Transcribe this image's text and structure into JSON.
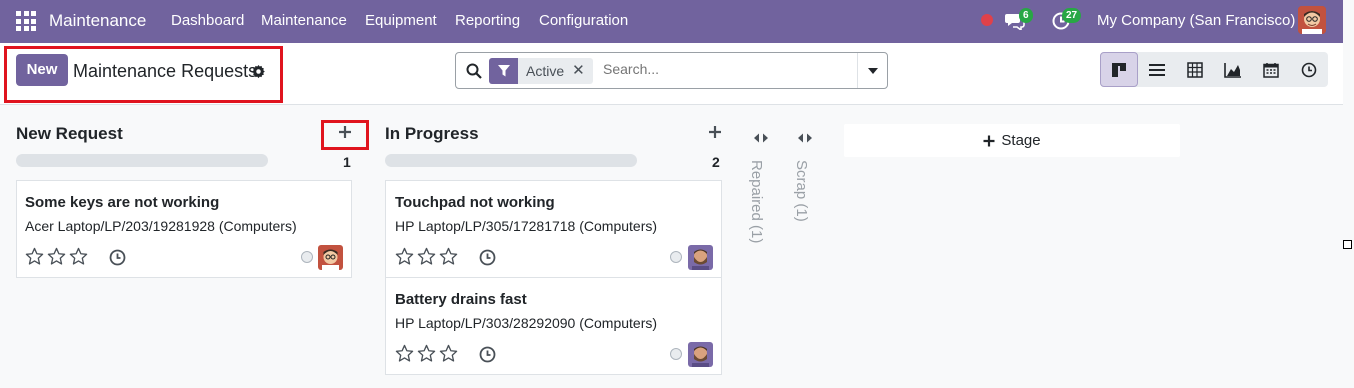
{
  "navbar": {
    "app_name": "Maintenance",
    "menu": [
      "Dashboard",
      "Maintenance",
      "Equipment",
      "Reporting",
      "Configuration"
    ],
    "messages_count": "6",
    "activities_count": "27",
    "company": "My Company (San Francisco)",
    "icons": [
      "apps-grid-icon",
      "status-dot-icon",
      "chat-icon",
      "activity-clock-icon"
    ]
  },
  "control": {
    "new_label": "New",
    "breadcrumb": "Maintenance Requests",
    "search": {
      "facet_label": "Active",
      "placeholder": "Search..."
    },
    "views": [
      "kanban-view-icon",
      "list-view-icon",
      "pivot-view-icon",
      "graph-view-icon",
      "calendar-view-icon",
      "activity-view-icon"
    ]
  },
  "kanban": {
    "columns": [
      {
        "title": "New Request",
        "count": "1",
        "cards": [
          {
            "title": "Some keys are not working",
            "subtitle": "Acer Laptop/LP/203/19281928 (Computers)"
          }
        ]
      },
      {
        "title": "In Progress",
        "count": "2",
        "cards": [
          {
            "title": "Touchpad not working",
            "subtitle": "HP Laptop/LP/305/17281718 (Computers)"
          },
          {
            "title": "Battery drains fast",
            "subtitle": "HP Laptop/LP/303/28292090 (Computers)"
          }
        ]
      }
    ],
    "folded": [
      "Repaired (1)",
      "Scrap (1)"
    ],
    "add_stage_label": "Stage"
  },
  "colors": {
    "brand": "#71639e",
    "highlight": "#e0141e",
    "badge": "#28a745"
  }
}
